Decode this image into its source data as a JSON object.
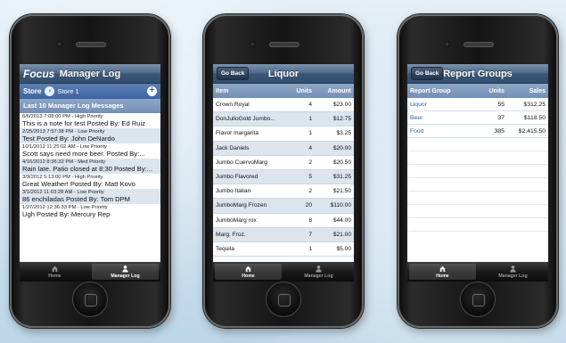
{
  "phones": {
    "manager_log": {
      "logo": "Focus",
      "title": "Manager Log",
      "store_label": "Store",
      "store_name": "Store 1",
      "section_header": "Last 10 Manager Log Messages",
      "messages": [
        {
          "meta": "6/6/2013 7:08:00 PM - High Priority",
          "text": "This is a note for test Posted By: Ed Ruiz"
        },
        {
          "meta": "2/25/2013 7:57:38 PM - Low Priority",
          "text": "Test Posted By: John DeNardo"
        },
        {
          "meta": "10/1/2012 11:25:02 AM - Low Priority",
          "text": "Scott says need more beer.  Posted By:..."
        },
        {
          "meta": "4/16/2012 8:36:32 PM - Med Priority",
          "text": "Rain late. Patio closed at 8:30 Posted By:..."
        },
        {
          "meta": "3/9/2012 5:13:00 PM - High Priority",
          "text": "Great Weather! Posted By: Matt Kovo"
        },
        {
          "meta": "3/1/2012 11:03:28 AM - Low Priority",
          "text": "86 enchiladas Posted By: Tom DPM"
        },
        {
          "meta": "1/27/2012 12:36:33 PM - Low Priority",
          "text": "Ugh Posted By: Mercury Rep"
        }
      ],
      "tabs": [
        {
          "label": "Home",
          "icon": "home-icon",
          "active": false
        },
        {
          "label": "Manager Log",
          "icon": "person-icon",
          "active": true
        }
      ]
    },
    "liquor": {
      "back_label": "Go Back",
      "title": "Liquor",
      "columns": {
        "item": "Item",
        "units": "Units",
        "amount": "Amount"
      },
      "rows": [
        {
          "item": "Crown Royal",
          "units": "4",
          "amount": "$23.00"
        },
        {
          "item": "DonJulioGold Jumbo...",
          "units": "1",
          "amount": "$12.75"
        },
        {
          "item": "Flavor  margarita",
          "units": "1",
          "amount": "$3.25"
        },
        {
          "item": "Jack Daniels",
          "units": "4",
          "amount": "$20.00"
        },
        {
          "item": "Jumbo CuervoMarg",
          "units": "2",
          "amount": "$20.50"
        },
        {
          "item": "Jumbo Flavored",
          "units": "5",
          "amount": "$31.25"
        },
        {
          "item": "Jumbo Italian",
          "units": "2",
          "amount": "$21.50"
        },
        {
          "item": "JumboMarg Frozen",
          "units": "20",
          "amount": "$110.00"
        },
        {
          "item": "JumboMarg rox",
          "units": "8",
          "amount": "$44.00"
        },
        {
          "item": "Marg. Froz.",
          "units": "7",
          "amount": "$21.00"
        },
        {
          "item": "Tequila",
          "units": "1",
          "amount": "$5.00"
        }
      ],
      "tabs": [
        {
          "label": "Home",
          "icon": "home-icon",
          "active": true
        },
        {
          "label": "Manager Log",
          "icon": "person-icon",
          "active": false
        }
      ]
    },
    "report_groups": {
      "back_label": "Go Back",
      "title": "Report Groups",
      "columns": {
        "group": "Report Group",
        "units": "Units",
        "sales": "Sales"
      },
      "rows": [
        {
          "group": "Liquor",
          "units": "55",
          "sales": "$312.25"
        },
        {
          "group": "Beer",
          "units": "37",
          "sales": "$118.50"
        },
        {
          "group": "Food",
          "units": "385",
          "sales": "$2,415.50"
        }
      ],
      "tabs": [
        {
          "label": "Home",
          "icon": "home-icon",
          "active": true
        },
        {
          "label": "Manager Log",
          "icon": "person-icon",
          "active": false
        }
      ]
    }
  }
}
